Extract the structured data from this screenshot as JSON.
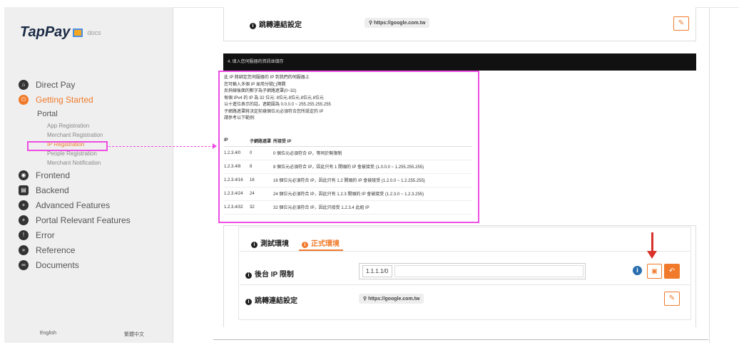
{
  "sidebar": {
    "logo": "TapPay",
    "logo_suffix": "docs",
    "items": [
      {
        "label": "Direct Pay",
        "icon": "home-icon"
      },
      {
        "label": "Getting Started",
        "icon": "power-icon"
      },
      {
        "label": "Frontend",
        "icon": "rss-icon"
      },
      {
        "label": "Backend",
        "icon": "server-icon"
      },
      {
        "label": "Advanced Features",
        "icon": "plus-icon"
      },
      {
        "label": "Portal Relevant Features",
        "icon": "plus-icon"
      },
      {
        "label": "Error",
        "icon": "warning-icon"
      },
      {
        "label": "Reference",
        "icon": "chevrons-up-icon"
      },
      {
        "label": "Documents",
        "icon": "link-icon"
      }
    ],
    "portal_label": "Portal",
    "portal_items": [
      "App Registration",
      "Merchant Registration",
      "IP Registration",
      "People Registration",
      "Merchant Notification"
    ],
    "lang_english": "English",
    "lang_chinese": "繁體中文"
  },
  "top_card": {
    "redirect_label": "跳轉連結設定",
    "redirect_url": "https://google.com.tw"
  },
  "step_bar": "4. 填入您伺服器的資訊並儲存",
  "ip_help": {
    "lines": [
      "此 IP 將綁定您伺服器的 IP 到我們的伺服器上",
      "您可輸入多個 IP 並用分號(;)隔開",
      "反斜線後面的數字為子網路遮罩(0~32)",
      "每個 IPv4 的 IP 為 32 位元: 8位元.8位元.8位元.8位元",
      "以十進位表示的話，遮範圍為 0.0.0.0 ~ 255.255.255.255",
      "子網路遮罩將決定前幾個位元必須符合您所設定的 IP",
      "請參考以下範例:"
    ],
    "table_headers": [
      "IP",
      "子網路遮罩",
      "所接受 IP"
    ],
    "rows": [
      [
        "1.2.3.4/0",
        "0",
        "0 個位元必須符合 IP，等同於無限制"
      ],
      [
        "1.2.3.4/8",
        "8",
        "8 個位元必須符合 IP，因此只有 1 開頭的 IP 會被接受 (1.0.0.0 ~ 1.255.255.255)"
      ],
      [
        "1.2.3.4/16",
        "16",
        "16 個位元必須符合 IP，因此只有 1.2 開頭的 IP 會被接受 (1.2.0.0 ~ 1.2.255.255)"
      ],
      [
        "1.2.3.4/24",
        "24",
        "24 個位元必須符合 IP，因此只有 1.2.3 開頭的 IP 會被接受 (1.2.3.0 ~ 1.2.3.255)"
      ],
      [
        "1.2.3.4/32",
        "32",
        "32 個位元必須符合 IP，因此只接受 1.2.3.4 此組 IP"
      ]
    ]
  },
  "env_card": {
    "tab_test": "測試環境",
    "tab_prod": "正式環境",
    "ip_limit_label": "後台 IP 限制",
    "ip_value": "1.1.1.1/0",
    "redirect_label": "跳轉連結設定",
    "redirect_url": "https://google.com.tw"
  },
  "colors": {
    "accent": "#f07a2a",
    "highlight": "#ee4de3",
    "arrow": "#d8322a"
  }
}
